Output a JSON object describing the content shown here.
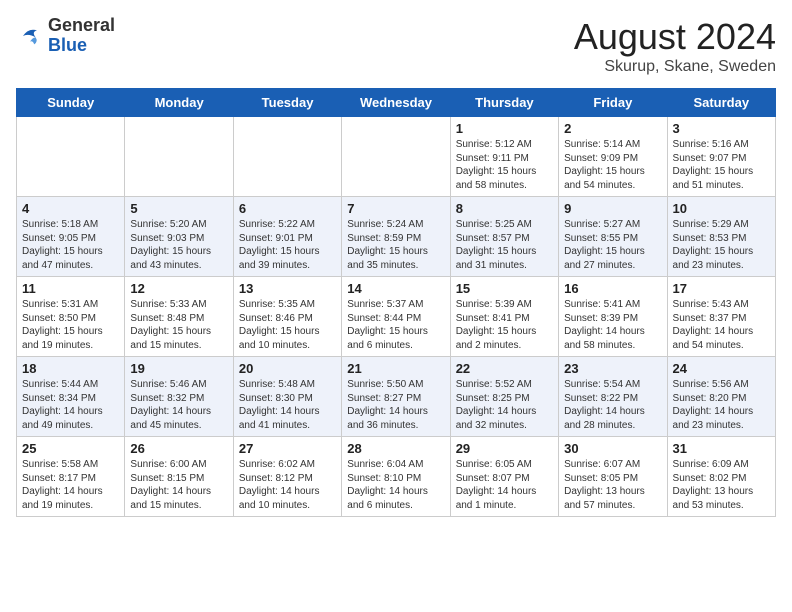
{
  "header": {
    "logo_general": "General",
    "logo_blue": "Blue",
    "title": "August 2024",
    "subtitle": "Skurup, Skane, Sweden"
  },
  "days_of_week": [
    "Sunday",
    "Monday",
    "Tuesday",
    "Wednesday",
    "Thursday",
    "Friday",
    "Saturday"
  ],
  "weeks": [
    [
      {
        "num": "",
        "info": "",
        "empty": true
      },
      {
        "num": "",
        "info": "",
        "empty": true
      },
      {
        "num": "",
        "info": "",
        "empty": true
      },
      {
        "num": "",
        "info": "",
        "empty": true
      },
      {
        "num": "1",
        "info": "Sunrise: 5:12 AM\nSunset: 9:11 PM\nDaylight: 15 hours\nand 58 minutes."
      },
      {
        "num": "2",
        "info": "Sunrise: 5:14 AM\nSunset: 9:09 PM\nDaylight: 15 hours\nand 54 minutes."
      },
      {
        "num": "3",
        "info": "Sunrise: 5:16 AM\nSunset: 9:07 PM\nDaylight: 15 hours\nand 51 minutes."
      }
    ],
    [
      {
        "num": "4",
        "info": "Sunrise: 5:18 AM\nSunset: 9:05 PM\nDaylight: 15 hours\nand 47 minutes."
      },
      {
        "num": "5",
        "info": "Sunrise: 5:20 AM\nSunset: 9:03 PM\nDaylight: 15 hours\nand 43 minutes."
      },
      {
        "num": "6",
        "info": "Sunrise: 5:22 AM\nSunset: 9:01 PM\nDaylight: 15 hours\nand 39 minutes."
      },
      {
        "num": "7",
        "info": "Sunrise: 5:24 AM\nSunset: 8:59 PM\nDaylight: 15 hours\nand 35 minutes."
      },
      {
        "num": "8",
        "info": "Sunrise: 5:25 AM\nSunset: 8:57 PM\nDaylight: 15 hours\nand 31 minutes."
      },
      {
        "num": "9",
        "info": "Sunrise: 5:27 AM\nSunset: 8:55 PM\nDaylight: 15 hours\nand 27 minutes."
      },
      {
        "num": "10",
        "info": "Sunrise: 5:29 AM\nSunset: 8:53 PM\nDaylight: 15 hours\nand 23 minutes."
      }
    ],
    [
      {
        "num": "11",
        "info": "Sunrise: 5:31 AM\nSunset: 8:50 PM\nDaylight: 15 hours\nand 19 minutes."
      },
      {
        "num": "12",
        "info": "Sunrise: 5:33 AM\nSunset: 8:48 PM\nDaylight: 15 hours\nand 15 minutes."
      },
      {
        "num": "13",
        "info": "Sunrise: 5:35 AM\nSunset: 8:46 PM\nDaylight: 15 hours\nand 10 minutes."
      },
      {
        "num": "14",
        "info": "Sunrise: 5:37 AM\nSunset: 8:44 PM\nDaylight: 15 hours\nand 6 minutes."
      },
      {
        "num": "15",
        "info": "Sunrise: 5:39 AM\nSunset: 8:41 PM\nDaylight: 15 hours\nand 2 minutes."
      },
      {
        "num": "16",
        "info": "Sunrise: 5:41 AM\nSunset: 8:39 PM\nDaylight: 14 hours\nand 58 minutes."
      },
      {
        "num": "17",
        "info": "Sunrise: 5:43 AM\nSunset: 8:37 PM\nDaylight: 14 hours\nand 54 minutes."
      }
    ],
    [
      {
        "num": "18",
        "info": "Sunrise: 5:44 AM\nSunset: 8:34 PM\nDaylight: 14 hours\nand 49 minutes."
      },
      {
        "num": "19",
        "info": "Sunrise: 5:46 AM\nSunset: 8:32 PM\nDaylight: 14 hours\nand 45 minutes."
      },
      {
        "num": "20",
        "info": "Sunrise: 5:48 AM\nSunset: 8:30 PM\nDaylight: 14 hours\nand 41 minutes."
      },
      {
        "num": "21",
        "info": "Sunrise: 5:50 AM\nSunset: 8:27 PM\nDaylight: 14 hours\nand 36 minutes."
      },
      {
        "num": "22",
        "info": "Sunrise: 5:52 AM\nSunset: 8:25 PM\nDaylight: 14 hours\nand 32 minutes."
      },
      {
        "num": "23",
        "info": "Sunrise: 5:54 AM\nSunset: 8:22 PM\nDaylight: 14 hours\nand 28 minutes."
      },
      {
        "num": "24",
        "info": "Sunrise: 5:56 AM\nSunset: 8:20 PM\nDaylight: 14 hours\nand 23 minutes."
      }
    ],
    [
      {
        "num": "25",
        "info": "Sunrise: 5:58 AM\nSunset: 8:17 PM\nDaylight: 14 hours\nand 19 minutes."
      },
      {
        "num": "26",
        "info": "Sunrise: 6:00 AM\nSunset: 8:15 PM\nDaylight: 14 hours\nand 15 minutes."
      },
      {
        "num": "27",
        "info": "Sunrise: 6:02 AM\nSunset: 8:12 PM\nDaylight: 14 hours\nand 10 minutes."
      },
      {
        "num": "28",
        "info": "Sunrise: 6:04 AM\nSunset: 8:10 PM\nDaylight: 14 hours\nand 6 minutes."
      },
      {
        "num": "29",
        "info": "Sunrise: 6:05 AM\nSunset: 8:07 PM\nDaylight: 14 hours\nand 1 minute."
      },
      {
        "num": "30",
        "info": "Sunrise: 6:07 AM\nSunset: 8:05 PM\nDaylight: 13 hours\nand 57 minutes."
      },
      {
        "num": "31",
        "info": "Sunrise: 6:09 AM\nSunset: 8:02 PM\nDaylight: 13 hours\nand 53 minutes."
      }
    ]
  ]
}
